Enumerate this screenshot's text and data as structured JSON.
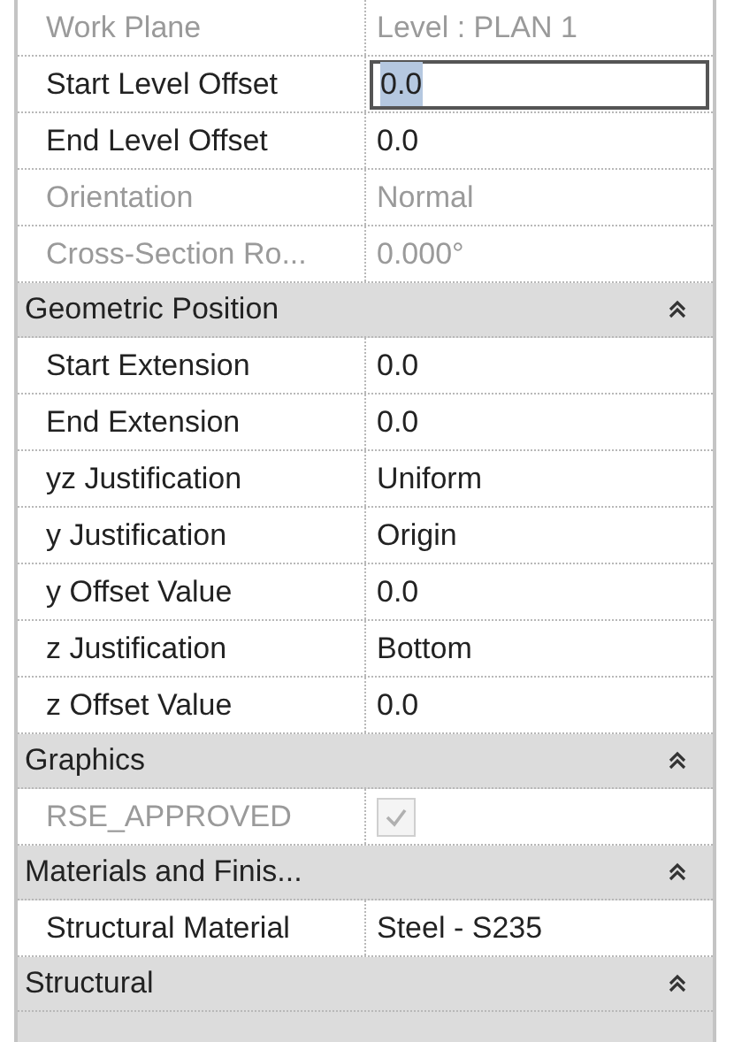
{
  "sections": [
    {
      "rows": [
        {
          "kind": "text",
          "label": "Work Plane",
          "value": "Level : PLAN 1",
          "disabled": true,
          "editing": false
        },
        {
          "kind": "text",
          "label": "Start Level Offset",
          "value": "0.0",
          "disabled": false,
          "editing": true
        },
        {
          "kind": "text",
          "label": "End Level Offset",
          "value": "0.0",
          "disabled": false,
          "editing": false
        },
        {
          "kind": "text",
          "label": "Orientation",
          "value": "Normal",
          "disabled": true,
          "editing": false
        },
        {
          "kind": "text",
          "label": "Cross-Section Ro...",
          "value": "0.000°",
          "disabled": true,
          "editing": false
        }
      ]
    },
    {
      "title": "Geometric Position",
      "expanded": true,
      "rows": [
        {
          "kind": "text",
          "label": "Start Extension",
          "value": "0.0",
          "disabled": false,
          "editing": false
        },
        {
          "kind": "text",
          "label": "End Extension",
          "value": "0.0",
          "disabled": false,
          "editing": false
        },
        {
          "kind": "text",
          "label": "yz Justification",
          "value": "Uniform",
          "disabled": false,
          "editing": false
        },
        {
          "kind": "text",
          "label": "y Justification",
          "value": "Origin",
          "disabled": false,
          "editing": false
        },
        {
          "kind": "text",
          "label": "y Offset Value",
          "value": "0.0",
          "disabled": false,
          "editing": false
        },
        {
          "kind": "text",
          "label": "z Justification",
          "value": "Bottom",
          "disabled": false,
          "editing": false
        },
        {
          "kind": "text",
          "label": "z Offset Value",
          "value": "0.0",
          "disabled": false,
          "editing": false
        }
      ]
    },
    {
      "title": "Graphics",
      "expanded": true,
      "rows": [
        {
          "kind": "checkbox",
          "label": "RSE_APPROVED",
          "checked": true,
          "disabled": true
        }
      ]
    },
    {
      "title": "Materials and Finis...",
      "expanded": true,
      "rows": [
        {
          "kind": "text",
          "label": "Structural Material",
          "value": "Steel - S235",
          "disabled": false,
          "editing": false
        }
      ]
    },
    {
      "title": "Structural",
      "expanded": true
    }
  ]
}
